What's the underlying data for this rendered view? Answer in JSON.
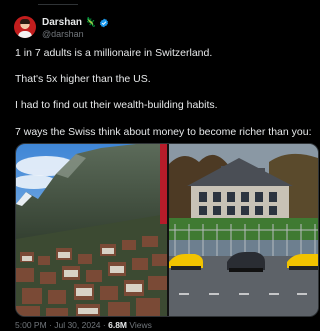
{
  "author": {
    "display_name": "Darshan",
    "handle": "@darshan",
    "name_emoji": "🦎"
  },
  "tweet": {
    "lines": [
      "1 in 7 adults is a millionaire in Switzerland.",
      "That's 5x higher than the US.",
      "I had to find out their wealth-building habits.",
      "7 ways the Swiss think about money to become richer than you:"
    ]
  },
  "meta": {
    "time": "5:00 PM",
    "separator": " · ",
    "date": "Jul 30, 2024",
    "views_count": "6.8M",
    "views_label": " Views"
  },
  "colors": {
    "background": "#000000",
    "text": "#e7e9ea",
    "secondary": "#71767b",
    "verified": "#1d9bf0"
  },
  "icons": {
    "verified": "verified-badge-icon",
    "emoji": "lizard-emoji"
  }
}
